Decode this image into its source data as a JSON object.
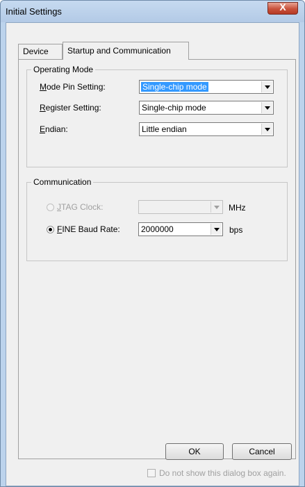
{
  "window": {
    "title": "Initial Settings",
    "close_glyph": "X"
  },
  "tabs": [
    {
      "label": "Device",
      "active": false
    },
    {
      "label": "Startup and Communication",
      "active": true
    }
  ],
  "operating_mode": {
    "legend": "Operating Mode",
    "mode_pin": {
      "mnemonic": "M",
      "label_rest": "ode Pin Setting:",
      "value": "Single-chip mode"
    },
    "register": {
      "mnemonic": "R",
      "label_rest": "egister Setting:",
      "value": "Single-chip mode"
    },
    "endian": {
      "mnemonic": "E",
      "label_rest": "ndian:",
      "value": "Little endian"
    }
  },
  "communication": {
    "legend": "Communication",
    "jtag": {
      "mnemonic": "J",
      "label_rest": "TAG Clock:",
      "value": "",
      "unit": "MHz",
      "selected": false,
      "enabled": false
    },
    "fine": {
      "mnemonic": "F",
      "label_rest": "INE Baud Rate:",
      "value": "2000000",
      "unit": "bps",
      "selected": true,
      "enabled": true
    }
  },
  "buttons": {
    "ok": "OK",
    "cancel": "Cancel"
  },
  "footer": {
    "dont_show": "Do not show this dialog box again.",
    "dont_show_checked": false
  }
}
